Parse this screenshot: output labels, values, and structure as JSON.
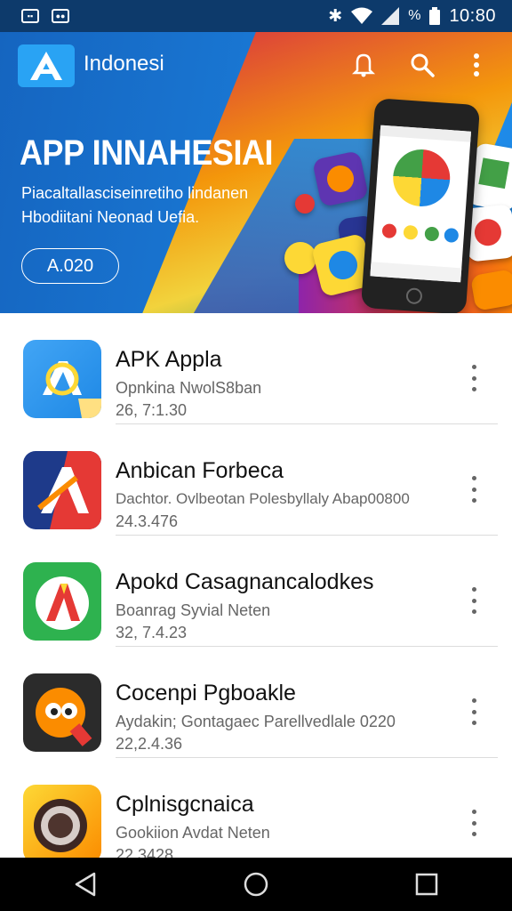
{
  "status_bar": {
    "time": "10:80"
  },
  "app_bar": {
    "title": "Indonesi"
  },
  "banner": {
    "title": "APP INNAHESIAI",
    "description": "Piacaltallasciseinretiho lindanen Hbodiitani Neonad Uefia.",
    "button_label": "A.020"
  },
  "apps": [
    {
      "name": "APK Appla",
      "subtitle": "Opnkina NwolS8ban",
      "date": "26, 7:1.30"
    },
    {
      "name": "Anbican Forbeca",
      "subtitle": "Dachtor. Ovlbeotan Polesbyllaly Abap00800",
      "date": "24.3.476"
    },
    {
      "name": "Apokd Casagnancalodkes",
      "subtitle": "Boanrag Syvial Neten",
      "date": "32, 7.4.23"
    },
    {
      "name": "Cocenpi Pgboakle",
      "subtitle": "Aydakin; Gontagaec Parellvedlale 0220",
      "date": "22,2.4.36"
    },
    {
      "name": "Cplnisgcnaica",
      "subtitle": "Gookiion Avdat Neten",
      "date": "22.3428"
    }
  ],
  "colors": {
    "status_bar": "#0d3a6b",
    "banner_blue": "#1976d2",
    "accent": "#29a3f4",
    "nav_bar": "#000000"
  },
  "icons": [
    "notification-bell-icon",
    "search-icon",
    "more-vert-icon",
    "back-icon",
    "home-icon",
    "recents-icon"
  ]
}
